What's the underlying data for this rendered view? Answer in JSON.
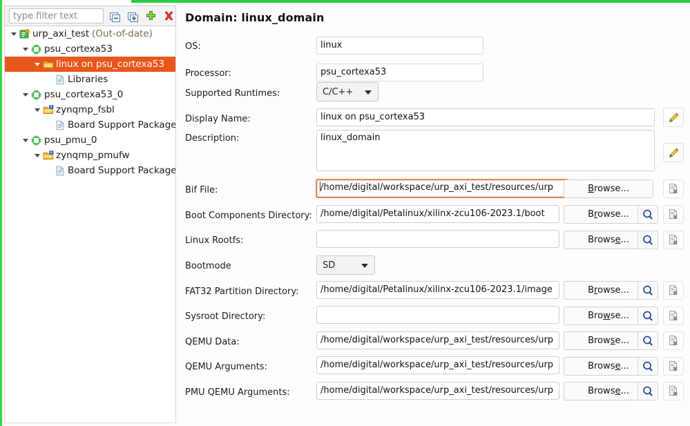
{
  "window": {
    "accent_green": "#2ecc44",
    "selection_orange": "#e8571c"
  },
  "tree_panel": {
    "filter": {
      "placeholder": "type filter text",
      "value": ""
    },
    "toolbar": [
      {
        "name": "collapse-all-icon",
        "tooltip": "Collapse All"
      },
      {
        "name": "expand-all-icon",
        "tooltip": "Expand All"
      },
      {
        "name": "add-icon",
        "tooltip": "Add"
      },
      {
        "name": "delete-icon",
        "tooltip": "Delete"
      }
    ],
    "items": [
      {
        "label": "urp_axi_test",
        "suffix": "(Out-of-date)",
        "icon": "platform-icon",
        "depth": 0,
        "expanded": true,
        "selected": false
      },
      {
        "label": "psu_cortexa53",
        "suffix": "",
        "icon": "processor-icon",
        "depth": 1,
        "expanded": true,
        "selected": false
      },
      {
        "label": "linux on psu_cortexa53",
        "suffix": "",
        "icon": "domain-folder-icon",
        "depth": 2,
        "expanded": true,
        "selected": true
      },
      {
        "label": "Libraries",
        "suffix": "",
        "icon": "file-icon",
        "depth": 3,
        "expanded": false,
        "selected": false
      },
      {
        "label": "psu_cortexa53_0",
        "suffix": "",
        "icon": "processor-icon",
        "depth": 1,
        "expanded": true,
        "selected": false
      },
      {
        "label": "zynqmp_fsbl",
        "suffix": "",
        "icon": "bsp-folder-icon",
        "depth": 2,
        "expanded": true,
        "selected": false
      },
      {
        "label": "Board Support Package",
        "suffix": "",
        "icon": "file-icon",
        "depth": 3,
        "expanded": false,
        "selected": false
      },
      {
        "label": "psu_pmu_0",
        "suffix": "",
        "icon": "processor-icon",
        "depth": 1,
        "expanded": true,
        "selected": false
      },
      {
        "label": "zynqmp_pmufw",
        "suffix": "",
        "icon": "bsp-folder-icon",
        "depth": 2,
        "expanded": true,
        "selected": false
      },
      {
        "label": "Board Support Package",
        "suffix": "",
        "icon": "file-icon",
        "depth": 3,
        "expanded": false,
        "selected": false
      }
    ]
  },
  "form": {
    "title": "Domain: linux_domain",
    "os": {
      "label": "OS:",
      "value": "linux"
    },
    "processor": {
      "label": "Processor:",
      "value": "psu_cortexa53"
    },
    "runtimes": {
      "label": "Supported Runtimes:",
      "value": "C/C++"
    },
    "display_name": {
      "label": "Display Name:",
      "value": "linux on psu_cortexa53"
    },
    "description": {
      "label": "Description:",
      "value": "linux_domain"
    },
    "bif_file": {
      "label": "Bif File:",
      "value": "/home/digital/workspace/urp_axi_test/resources/urp"
    },
    "boot_components": {
      "label": "Boot Components Directory:",
      "value": "/home/digital/Petalinux/xilinx-zcu106-2023.1/boot"
    },
    "linux_rootfs": {
      "label": "Linux Rootfs:",
      "value": ""
    },
    "bootmode": {
      "label": "Bootmode",
      "value": "SD"
    },
    "fat32": {
      "label": "FAT32 Partition Directory:",
      "value": "/home/digital/Petalinux/xilinx-zcu106-2023.1/image"
    },
    "sysroot": {
      "label": "Sysroot Directory:",
      "value": ""
    },
    "qemu_data": {
      "label": "QEMU Data:",
      "value": "/home/digital/workspace/urp_axi_test/resources/urp"
    },
    "qemu_args": {
      "label": "QEMU Arguments:",
      "value": "/home/digital/workspace/urp_axi_test/resources/urp"
    },
    "pmu_qemu_args": {
      "label": "PMU QEMU Arguments:",
      "value": "/home/digital/workspace/urp_axi_test/resources/urp"
    },
    "browse_prefix": "B",
    "browse_label": "Browse...",
    "browse_mnemonics": [
      "B",
      "r",
      "o",
      "w",
      "s",
      "e"
    ],
    "icons": {
      "edit": "pencil-icon",
      "search": "magnifier-icon",
      "clear": "clear-file-icon",
      "combo_arrow": "chevron-down-icon"
    }
  }
}
